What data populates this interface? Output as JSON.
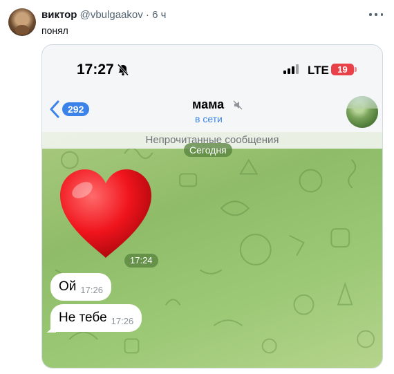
{
  "tweet": {
    "display_name": "виктор",
    "handle": "@vbulgaakov",
    "separator": "·",
    "time_ago": "6 ч",
    "text": "понял"
  },
  "phone": {
    "status_time": "17:27",
    "network": "LTE",
    "battery": "19",
    "icons": [
      "bell-slash-icon",
      "signal-bars-icon"
    ]
  },
  "chat": {
    "back_count": "292",
    "name": "мама",
    "status": "в сети",
    "unread_banner": "Непрочитанные сообщения",
    "date_divider": "Сегодня",
    "sticker_time": "17:24",
    "messages": [
      {
        "text": "Ой",
        "time": "17:26"
      },
      {
        "text": "Не тебе",
        "time": "17:26"
      }
    ]
  },
  "colors": {
    "accent_blue": "#3b83e8",
    "battery_red": "#e8414a",
    "wallpaper_green": "#9ac874"
  }
}
